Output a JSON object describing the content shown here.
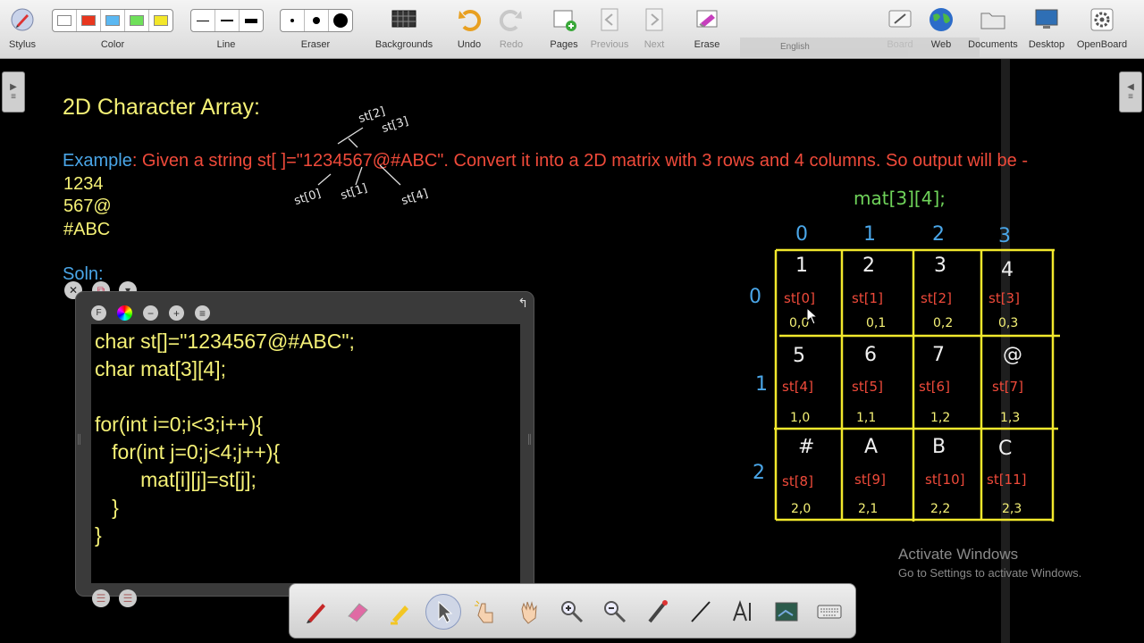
{
  "toolbar": {
    "stylus": "Stylus",
    "color": "Color",
    "line": "Line",
    "eraser": "Eraser",
    "backgrounds": "Backgrounds",
    "undo": "Undo",
    "redo": "Redo",
    "pages": "Pages",
    "previous": "Previous",
    "next": "Next",
    "erase": "Erase",
    "board": "Board",
    "web": "Web",
    "documents": "Documents",
    "desktop": "Desktop",
    "openboard": "OpenBoard",
    "language": "English",
    "colors": [
      "#ffffff",
      "#e8371f",
      "#5bb8f2",
      "#6fe05a",
      "#f3e72a"
    ]
  },
  "board": {
    "title": "2D Character Array:",
    "example_label": "Example",
    "example_text": ": Given a string st[ ]=\"1234567@#ABC\". Convert it into a 2D matrix with 3 rows and 4 columns. So output will be -",
    "output_lines": [
      "1234",
      "567@",
      "#ABC"
    ],
    "soln_label": "Soln:"
  },
  "code": {
    "lines": [
      "char st[]=\"1234567@#ABC\";",
      "char mat[3][4];",
      "",
      "for(int i=0;i<3;i++){",
      "   for(int j=0;j<4;j++){",
      "        mat[i][j]=st[j];",
      "   }",
      "}"
    ]
  },
  "sketch": {
    "labels": [
      "st[2]",
      "st[3]",
      "st[0]",
      "st[1]",
      "st[4]"
    ]
  },
  "matrix": {
    "declaration": "mat[3][4];",
    "col_headers": [
      "0",
      "1",
      "2",
      "3"
    ],
    "row_headers": [
      "0",
      "1",
      "2"
    ],
    "cells": [
      [
        {
          "ch": "1",
          "src": "st[0]",
          "idx": "0,0"
        },
        {
          "ch": "2",
          "src": "st[1]",
          "idx": "0,1"
        },
        {
          "ch": "3",
          "src": "st[2]",
          "idx": "0,2"
        },
        {
          "ch": "4",
          "src": "st[3]",
          "idx": "0,3"
        }
      ],
      [
        {
          "ch": "5",
          "src": "st[4]",
          "idx": "1,0"
        },
        {
          "ch": "6",
          "src": "st[5]",
          "idx": "1,1"
        },
        {
          "ch": "7",
          "src": "st[6]",
          "idx": "1,2"
        },
        {
          "ch": "@",
          "src": "st[7]",
          "idx": "1,3"
        }
      ],
      [
        {
          "ch": "#",
          "src": "st[8]",
          "idx": "2,0"
        },
        {
          "ch": "A",
          "src": "st[9]",
          "idx": "2,1"
        },
        {
          "ch": "B",
          "src": "st[10]",
          "idx": "2,2"
        },
        {
          "ch": "C",
          "src": "st[11]",
          "idx": "2,3"
        }
      ]
    ]
  },
  "watermark": {
    "line1": "Activate Windows",
    "line2": "Go to Settings to activate Windows."
  }
}
